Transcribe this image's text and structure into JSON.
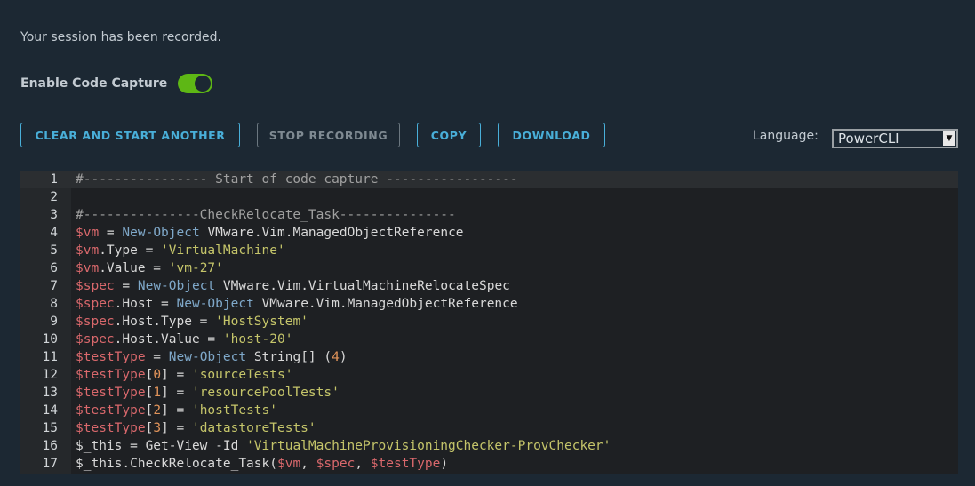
{
  "status_message": "Your session has been recorded.",
  "code_capture": {
    "label": "Enable Code Capture",
    "enabled": true,
    "toggle_color": "#5eb715"
  },
  "buttons": {
    "clear": "CLEAR AND START ANOTHER",
    "stop": "STOP RECORDING",
    "copy": "COPY",
    "download": "DOWNLOAD"
  },
  "language": {
    "label": "Language:",
    "selected": "PowerCLI"
  },
  "colors": {
    "background": "#1c2833",
    "accent": "#49afd9",
    "variable": "#d9686c",
    "keyword": "#7fa8c9",
    "string": "#c5c56a",
    "number": "#e0935a",
    "comment": "#a0a0a0"
  },
  "editor": {
    "active_line": 1,
    "lines": [
      [
        [
          "com",
          "#---------------- Start of code capture -----------------"
        ]
      ],
      [],
      [
        [
          "com",
          "#---------------CheckRelocate_Task---------------"
        ]
      ],
      [
        [
          "var",
          "$vm"
        ],
        [
          "plain",
          " = "
        ],
        [
          "kw",
          "New-Object"
        ],
        [
          "plain",
          " VMware.Vim.ManagedObjectReference"
        ]
      ],
      [
        [
          "var",
          "$vm"
        ],
        [
          "plain",
          ".Type = "
        ],
        [
          "str",
          "'VirtualMachine'"
        ]
      ],
      [
        [
          "var",
          "$vm"
        ],
        [
          "plain",
          ".Value = "
        ],
        [
          "str",
          "'vm-27'"
        ]
      ],
      [
        [
          "var",
          "$spec"
        ],
        [
          "plain",
          " = "
        ],
        [
          "kw",
          "New-Object"
        ],
        [
          "plain",
          " VMware.Vim.VirtualMachineRelocateSpec"
        ]
      ],
      [
        [
          "var",
          "$spec"
        ],
        [
          "plain",
          ".Host = "
        ],
        [
          "kw",
          "New-Object"
        ],
        [
          "plain",
          " VMware.Vim.ManagedObjectReference"
        ]
      ],
      [
        [
          "var",
          "$spec"
        ],
        [
          "plain",
          ".Host.Type = "
        ],
        [
          "str",
          "'HostSystem'"
        ]
      ],
      [
        [
          "var",
          "$spec"
        ],
        [
          "plain",
          ".Host.Value = "
        ],
        [
          "str",
          "'host-20'"
        ]
      ],
      [
        [
          "var",
          "$testType"
        ],
        [
          "plain",
          " = "
        ],
        [
          "kw",
          "New-Object"
        ],
        [
          "plain",
          " String[] ("
        ],
        [
          "num",
          "4"
        ],
        [
          "plain",
          ")"
        ]
      ],
      [
        [
          "var",
          "$testType"
        ],
        [
          "plain",
          "["
        ],
        [
          "num",
          "0"
        ],
        [
          "plain",
          "] = "
        ],
        [
          "str",
          "'sourceTests'"
        ]
      ],
      [
        [
          "var",
          "$testType"
        ],
        [
          "plain",
          "["
        ],
        [
          "num",
          "1"
        ],
        [
          "plain",
          "] = "
        ],
        [
          "str",
          "'resourcePoolTests'"
        ]
      ],
      [
        [
          "var",
          "$testType"
        ],
        [
          "plain",
          "["
        ],
        [
          "num",
          "2"
        ],
        [
          "plain",
          "] = "
        ],
        [
          "str",
          "'hostTests'"
        ]
      ],
      [
        [
          "var",
          "$testType"
        ],
        [
          "plain",
          "["
        ],
        [
          "num",
          "3"
        ],
        [
          "plain",
          "] = "
        ],
        [
          "str",
          "'datastoreTests'"
        ]
      ],
      [
        [
          "plain",
          "$_this = Get-View -Id "
        ],
        [
          "str",
          "'VirtualMachineProvisioningChecker-ProvChecker'"
        ]
      ],
      [
        [
          "plain",
          "$_this.CheckRelocate_Task("
        ],
        [
          "var",
          "$vm"
        ],
        [
          "plain",
          ", "
        ],
        [
          "var",
          "$spec"
        ],
        [
          "plain",
          ", "
        ],
        [
          "var",
          "$testType"
        ],
        [
          "plain",
          ")"
        ]
      ]
    ]
  }
}
